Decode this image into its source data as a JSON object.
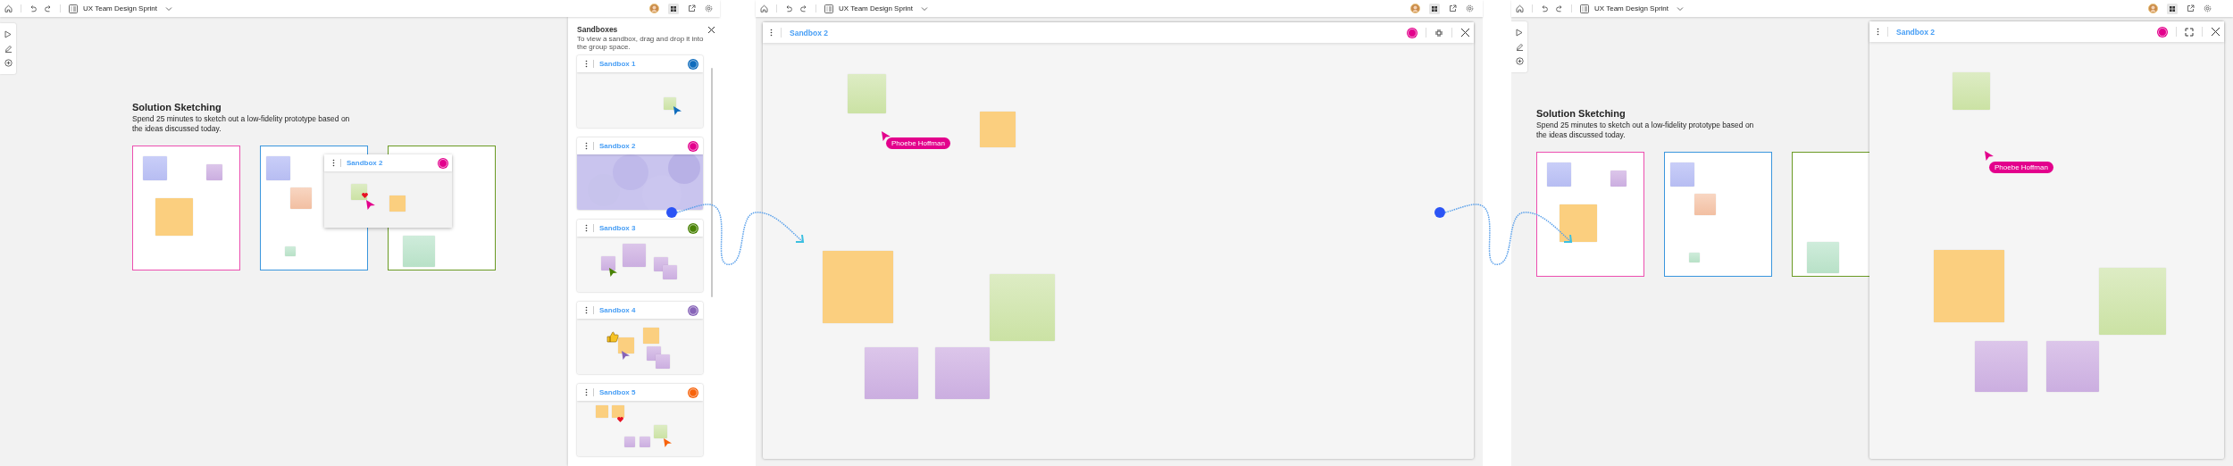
{
  "screens": [
    {
      "title": "UX Team Design Sprint",
      "board": {
        "heading": "Solution Sketching",
        "description": "Spend 25 minutes to sketch out a low-fidelity prototype based on the ideas discussed today."
      },
      "preview": {
        "title": "Sandbox 2"
      },
      "panel": {
        "title": "Sandboxes",
        "hint": "To view a sandbox, drag and drop it into the group space.",
        "sandboxes": [
          {
            "title": "Sandbox 1",
            "color": "#0f6cbd",
            "dragging": false
          },
          {
            "title": "Sandbox 2",
            "color": "#e3008c",
            "dragging": true
          },
          {
            "title": "Sandbox 3",
            "color": "#498205",
            "dragging": false
          },
          {
            "title": "Sandbox 4",
            "color": "#8764b8",
            "dragging": false
          },
          {
            "title": "Sandbox 5",
            "color": "#f7630c",
            "dragging": false
          }
        ]
      }
    },
    {
      "title": "UX Team Design Sprint",
      "window": {
        "title": "Sandbox 2",
        "maximized": true,
        "cursor_label": "Phoebe Hoffman"
      }
    },
    {
      "title": "UX Team Design Sprint",
      "board": {
        "heading": "Solution Sketching",
        "description": "Spend 25 minutes to sketch out a low-fidelity prototype based on the ideas discussed today."
      },
      "window": {
        "title": "Sandbox 2",
        "maximized": false,
        "cursor_label": "Phoebe Hoffman"
      }
    }
  ]
}
